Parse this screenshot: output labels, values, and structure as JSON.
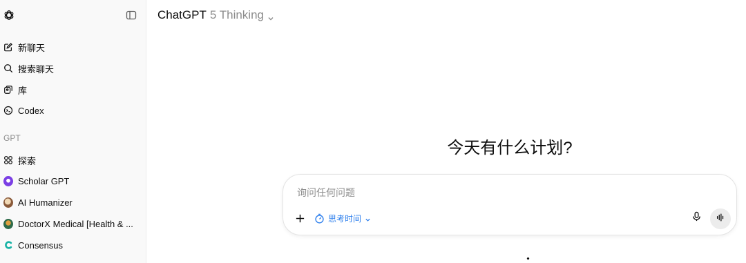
{
  "header": {
    "model": "ChatGPT",
    "variant": "5 Thinking"
  },
  "sidebar": {
    "items": [
      {
        "label": "新聊天",
        "icon": "edit-icon"
      },
      {
        "label": "搜索聊天",
        "icon": "search-icon"
      },
      {
        "label": "库",
        "icon": "library-icon"
      },
      {
        "label": "Codex",
        "icon": "codex-icon"
      }
    ],
    "section_label": "GPT",
    "gpts": [
      {
        "label": "探索",
        "icon": "explore-icon"
      },
      {
        "label": "Scholar GPT",
        "icon": "scholar-gpt-avatar"
      },
      {
        "label": "AI Humanizer",
        "icon": "ai-humanizer-avatar"
      },
      {
        "label": "DoctorX Medical [Health & ...",
        "icon": "doctorx-avatar"
      },
      {
        "label": "Consensus",
        "icon": "consensus-icon"
      }
    ]
  },
  "main": {
    "greeting": "今天有什么计划?"
  },
  "composer": {
    "placeholder": "询问任何问题",
    "thinking_label": "思考时间"
  },
  "colors": {
    "sidebar_bg": "#f9f9f9",
    "accent_blue": "#2f80ed",
    "muted_text": "#8c8c8c"
  }
}
